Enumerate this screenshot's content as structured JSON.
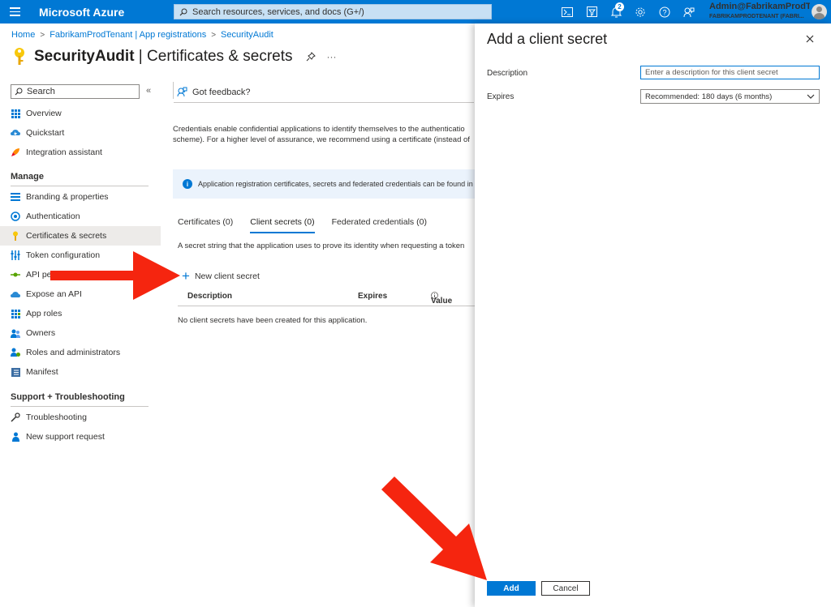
{
  "topbar": {
    "brand": "Microsoft Azure",
    "search_placeholder": "Search resources, services, and docs (G+/)",
    "notification_count": "2",
    "account_name": "Admin@FabrikamProdT...",
    "account_tenant": "FABRIKAMPRODTENANT (FABRI..."
  },
  "breadcrumb": {
    "items": [
      "Home",
      "FabrikamProdTenant | App registrations",
      "SecurityAudit"
    ],
    "separator": ">"
  },
  "page": {
    "title_app": "SecurityAudit",
    "title_section": " | Certificates & secrets",
    "more": "···"
  },
  "sidebar": {
    "search_placeholder": "Search",
    "collapse": "«",
    "top_items": [
      {
        "label": "Overview",
        "icon": "grid-icon"
      },
      {
        "label": "Quickstart",
        "icon": "cloud-lightning-icon"
      },
      {
        "label": "Integration assistant",
        "icon": "rocket-icon"
      }
    ],
    "manage_header": "Manage",
    "manage_items": [
      {
        "label": "Branding & properties",
        "icon": "branding-icon"
      },
      {
        "label": "Authentication",
        "icon": "authentication-icon"
      },
      {
        "label": "Certificates & secrets",
        "icon": "key-icon"
      },
      {
        "label": "Token configuration",
        "icon": "token-icon"
      },
      {
        "label": "API permissions",
        "icon": "api-icon"
      },
      {
        "label": "Expose an API",
        "icon": "cloud-icon"
      },
      {
        "label": "App roles",
        "icon": "app-roles-icon"
      },
      {
        "label": "Owners",
        "icon": "owners-icon"
      },
      {
        "label": "Roles and administrators",
        "icon": "roles-icon"
      },
      {
        "label": "Manifest",
        "icon": "manifest-icon"
      }
    ],
    "support_header": "Support + Troubleshooting",
    "support_items": [
      {
        "label": "Troubleshooting",
        "icon": "wrench-icon"
      },
      {
        "label": "New support request",
        "icon": "support-icon"
      }
    ]
  },
  "main": {
    "feedback": "Got feedback?",
    "description_line1": "Credentials enable confidential applications to identify themselves to the authenticatio",
    "description_line2": "scheme). For a higher level of assurance, we recommend using a certificate (instead of",
    "info": "Application registration certificates, secrets and federated credentials can be found in",
    "tabs": [
      {
        "label": "Certificates (0)"
      },
      {
        "label": "Client secrets (0)"
      },
      {
        "label": "Federated credentials (0)"
      }
    ],
    "tab_description": "A secret string that the application uses to prove its identity when requesting a token",
    "new_secret": "New client secret",
    "columns": {
      "description": "Description",
      "expires": "Expires",
      "value": "Value"
    },
    "empty_message": "No client secrets have been created for this application."
  },
  "panel": {
    "title": "Add a client secret",
    "description_label": "Description",
    "description_placeholder": "Enter a description for this client secret",
    "expires_label": "Expires",
    "expires_value": "Recommended: 180 days (6 months)",
    "add_label": "Add",
    "cancel_label": "Cancel"
  },
  "colors": {
    "accent": "#0078d4",
    "arrow": "#f5250f"
  }
}
